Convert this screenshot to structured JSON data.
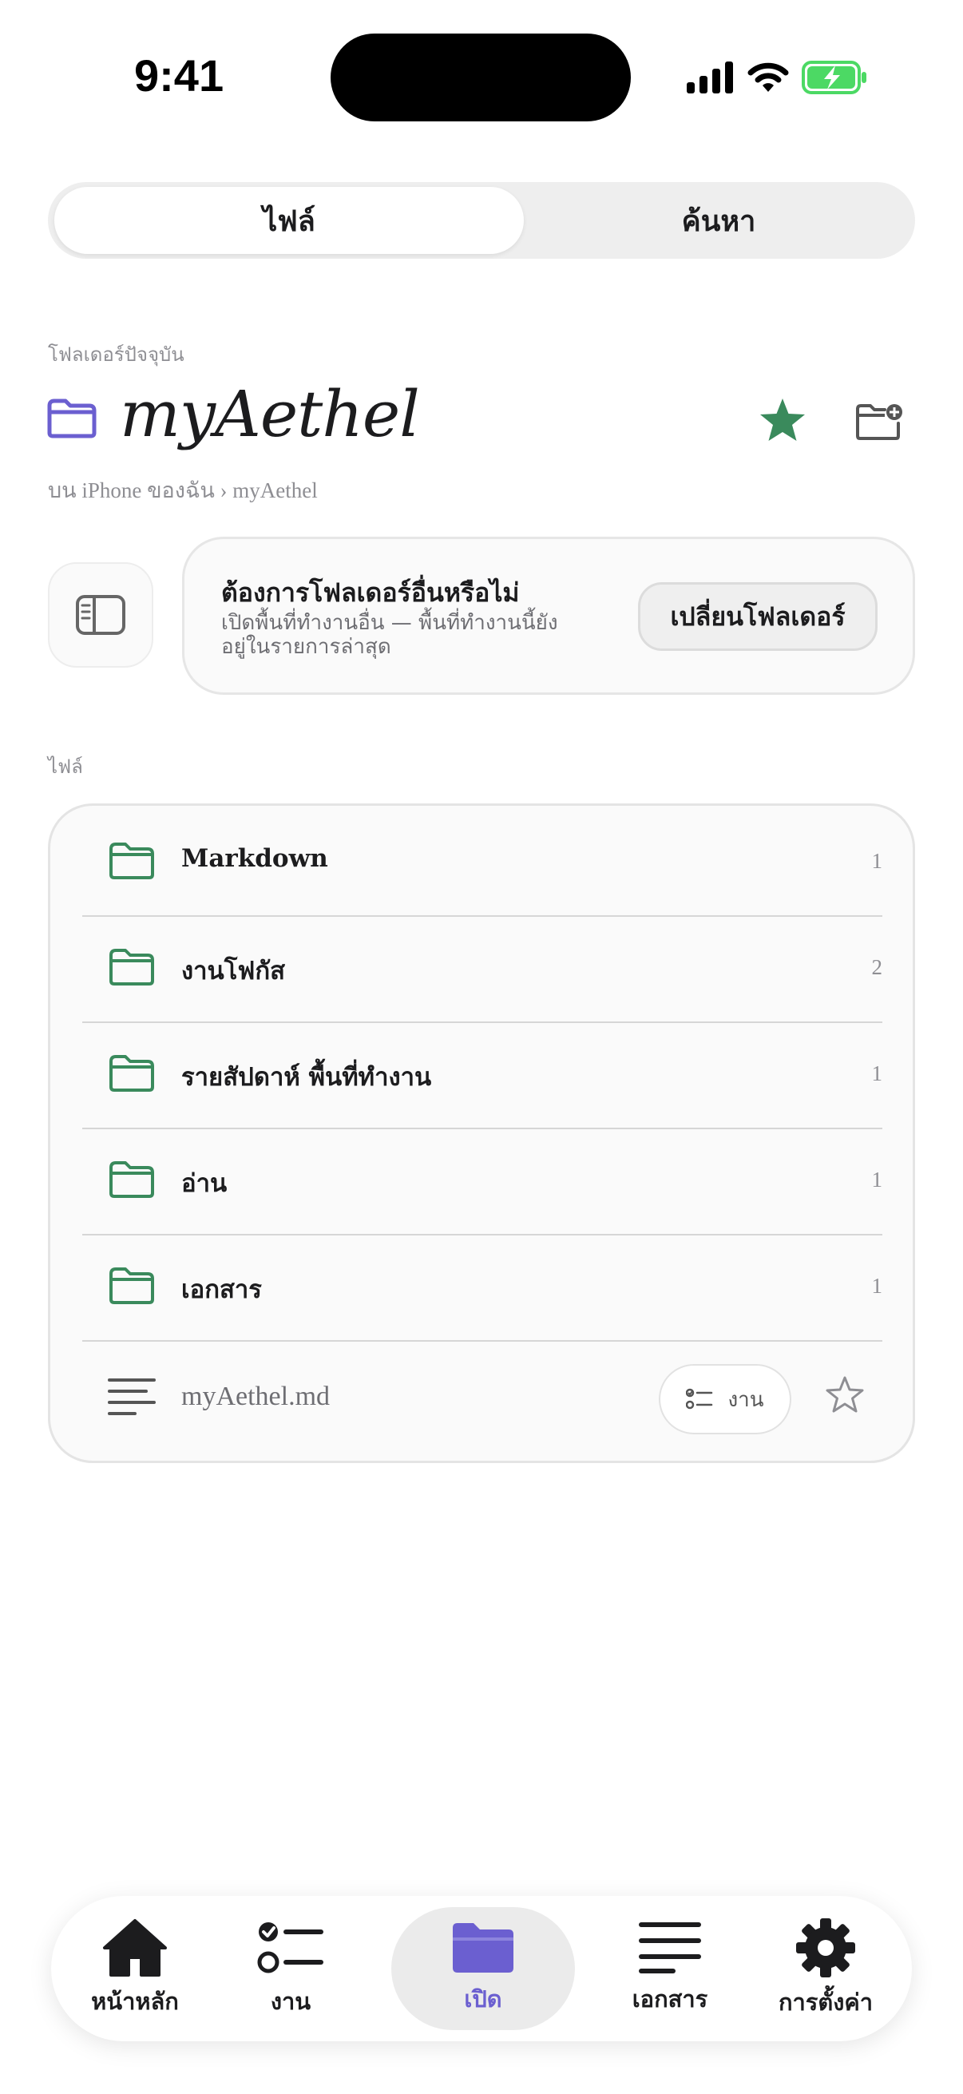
{
  "status_bar": {
    "time": "9:41"
  },
  "segmented": {
    "files_label": "ไฟล์",
    "search_label": "ค้นหา"
  },
  "current_folder": {
    "section_label": "โฟลเดอร์ปัจจุบัน",
    "title": "myAethel",
    "breadcrumb": "บน iPhone ของฉัน › myAethel"
  },
  "switch_card": {
    "title": "ต้องการโฟลเดอร์อื่นหรือไม่",
    "description": "เปิดพื้นที่ทำงานอื่น — พื้นที่ทำงานนี้ยังอยู่ในรายการล่าสุด",
    "button_label": "เปลี่ยนโฟลเดอร์"
  },
  "files": {
    "section_label": "ไฟล์",
    "folders": [
      {
        "label": "Markdown",
        "count": "1"
      },
      {
        "label": "งานโฟกัส",
        "count": "2"
      },
      {
        "label": "รายสัปดาห์ พื้นที่ทำงาน",
        "count": "1"
      },
      {
        "label": "อ่าน",
        "count": "1"
      },
      {
        "label": "เอกสาร",
        "count": "1"
      }
    ],
    "file": {
      "name": "myAethel.md",
      "chip_label": "งาน"
    }
  },
  "tab_bar": {
    "tabs": [
      {
        "label": "หน้าหลัก",
        "icon": "house-icon"
      },
      {
        "label": "งาน",
        "icon": "checklist-icon"
      },
      {
        "label": "เปิด",
        "icon": "folder-icon"
      },
      {
        "label": "เอกสาร",
        "icon": "text-lines-icon"
      },
      {
        "label": "การตั้งค่า",
        "icon": "gear-icon"
      }
    ],
    "active_index": 2
  },
  "colors": {
    "accent_purple": "#6b5fd0",
    "folder_green": "#3a8a5c",
    "star_green": "#3a8a5c",
    "battery_green": "#4cd964"
  }
}
